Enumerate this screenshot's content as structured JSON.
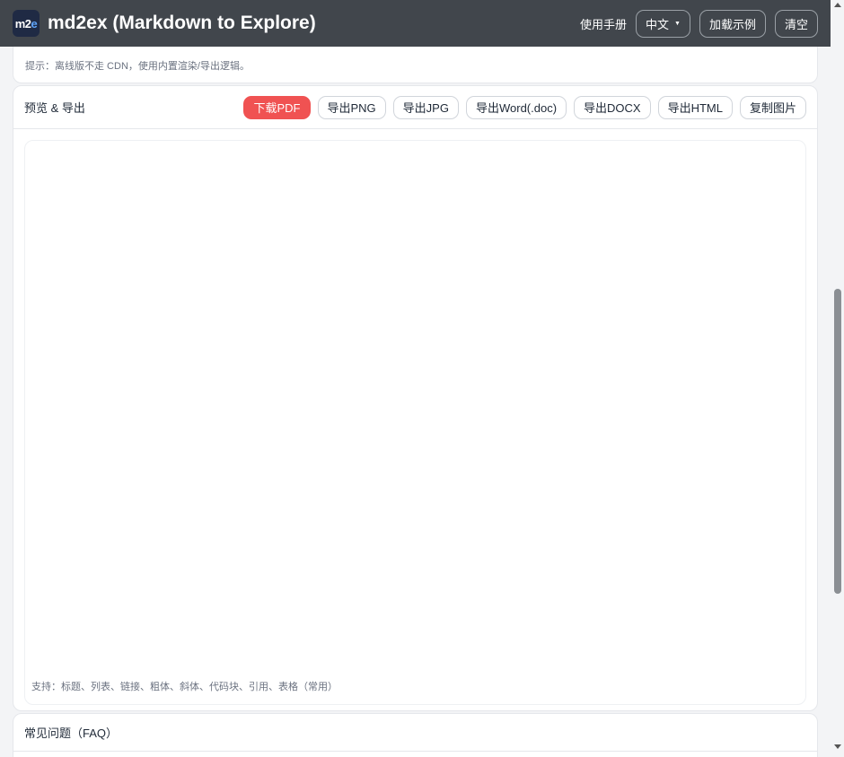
{
  "app": {
    "logo_text_main": "m2",
    "logo_text_accent": "e",
    "title": "md2ex (Markdown to Explore)"
  },
  "topbar": {
    "manual_label": "使用手册",
    "language_selected": "中文",
    "load_example_label": "加载示例",
    "clear_label": "清空"
  },
  "hint": {
    "text": "提示：离线版不走 CDN，使用内置渲染/导出逻辑。"
  },
  "preview": {
    "title": "预览 & 导出",
    "buttons": [
      {
        "label": "下载PDF"
      },
      {
        "label": "导出PNG"
      },
      {
        "label": "导出JPG"
      },
      {
        "label": "导出Word(.doc)"
      },
      {
        "label": "导出DOCX"
      },
      {
        "label": "导出HTML"
      },
      {
        "label": "复制图片"
      }
    ],
    "support_text": "支持：标题、列表、链接、粗体、斜体、代码块、引用、表格（常用）"
  },
  "faq": {
    "title": "常见问题（FAQ）"
  },
  "colors": {
    "topbar_bg": "#41464c",
    "primary_button": "#f05252",
    "page_bg": "#f3f4f6"
  },
  "icons": {
    "language_dropdown": "caret-down-icon"
  }
}
